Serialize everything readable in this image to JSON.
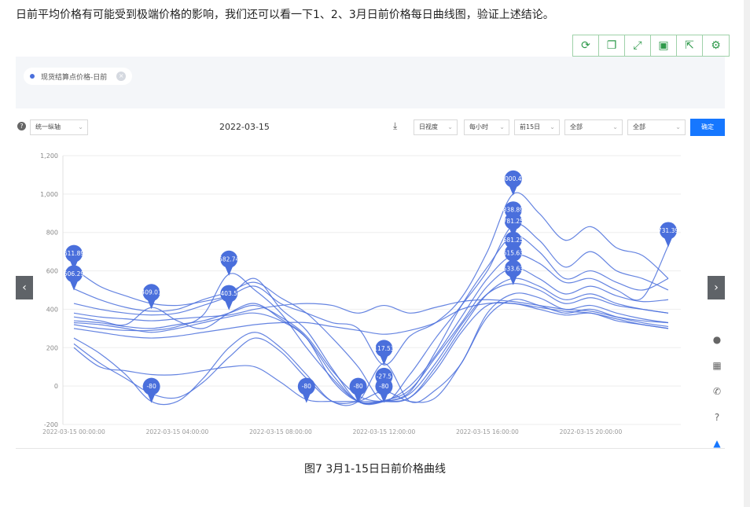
{
  "intro_text": "日前平均价格有可能受到极端价格的影响，我们还可以看一下1、2、3月日前价格每日曲线图，验证上述结论。",
  "toolbar": {
    "icons": [
      "refresh-icon",
      "copy-icon",
      "fullscreen-icon",
      "save-icon",
      "share-icon",
      "settings-icon"
    ]
  },
  "legend": {
    "item": "现货结算点价格-日前",
    "color": "#4a6fdc"
  },
  "controls": {
    "axis_mode": "统一纵轴",
    "date": "2022-03-15",
    "granularity": "日视度",
    "interval": "每小时",
    "range": "前15日",
    "filter1": "全部",
    "filter2": "全部",
    "confirm": "确定"
  },
  "caption": "图7  3月1-15日日前价格曲线",
  "chart_data": {
    "type": "line",
    "title": "",
    "xlabel": "",
    "ylabel": "",
    "ylim": [
      -200,
      1200
    ],
    "yticks": [
      "-200",
      "0",
      "200",
      "400",
      "600",
      "800",
      "1,000",
      "1,200"
    ],
    "xtick_labels": [
      "2022-03-15 00:00:00",
      "2022-03-15 04:00:00",
      "2022-03-15 08:00:00",
      "2022-03-15 12:00:00",
      "2022-03-15 16:00:00",
      "2022-03-15 20:00:00"
    ],
    "x_hours": [
      0,
      1,
      2,
      3,
      4,
      5,
      6,
      7,
      8,
      9,
      10,
      11,
      12,
      13,
      14,
      15,
      16,
      17,
      18,
      19,
      20,
      21,
      22,
      23
    ],
    "series": [
      {
        "values": [
          611.89,
          520,
          470,
          430,
          420,
          440,
          470,
          520,
          430,
          380,
          330,
          300,
          110,
          260,
          330,
          460,
          700,
          1000.46,
          900,
          760,
          830,
          720,
          680,
          560
        ]
      },
      {
        "values": [
          506.29,
          450,
          410,
          390,
          400,
          450,
          490,
          540,
          460,
          380,
          250,
          100,
          -80,
          60,
          250,
          420,
          600,
          838.89,
          760,
          620,
          700,
          600,
          560,
          500
        ]
      },
      {
        "values": [
          320,
          300,
          290,
          290,
          310,
          370,
          582.74,
          500,
          380,
          200,
          40,
          -80,
          -80,
          -30,
          180,
          420,
          620,
          781.25,
          700,
          560,
          600,
          540,
          500,
          560
        ]
      },
      {
        "values": [
          430,
          400,
          380,
          370,
          380,
          420,
          470,
          560,
          403.5,
          290,
          90,
          -80,
          -80,
          0,
          160,
          360,
          560,
          681.25,
          640,
          540,
          560,
          500,
          460,
          731.39
        ]
      },
      {
        "values": [
          360,
          340,
          320,
          409.01,
          340,
          300,
          380,
          430,
          350,
          250,
          30,
          -80,
          -75,
          -20,
          150,
          330,
          520,
          615.63,
          560,
          480,
          520,
          470,
          440,
          450
        ]
      },
      {
        "values": [
          330,
          320,
          300,
          280,
          300,
          330,
          360,
          380,
          340,
          250,
          60,
          -80,
          -80,
          -40,
          120,
          320,
          480,
          533.63,
          500,
          430,
          460,
          420,
          400,
          380
        ]
      },
      {
        "values": [
          250,
          170,
          60,
          -80,
          -80,
          40,
          200,
          280,
          200,
          60,
          -80,
          -80,
          117.53,
          -80,
          -20,
          120,
          380,
          480,
          460,
          400,
          420,
          380,
          350,
          330
        ]
      },
      {
        "values": [
          220,
          120,
          40,
          -40,
          -60,
          20,
          150,
          250,
          180,
          40,
          -80,
          -80,
          -27.5,
          -80,
          -60,
          120,
          360,
          450,
          420,
          380,
          400,
          360,
          330,
          310
        ]
      },
      {
        "values": [
          200,
          100,
          80,
          60,
          60,
          80,
          100,
          100,
          20,
          -70,
          -80,
          -80,
          -80,
          -60,
          80,
          280,
          420,
          430,
          400,
          370,
          380,
          340,
          320,
          300
        ]
      },
      {
        "values": [
          300,
          280,
          260,
          250,
          260,
          280,
          300,
          320,
          330,
          330,
          310,
          290,
          270,
          290,
          330,
          400,
          430,
          430,
          410,
          390,
          380,
          350,
          320,
          300
        ]
      },
      {
        "values": [
          380,
          360,
          350,
          340,
          350,
          360,
          370,
          400,
          420,
          430,
          420,
          380,
          420,
          380,
          410,
          440,
          450,
          440,
          420,
          400,
          390,
          360,
          340,
          330
        ]
      },
      {
        "values": [
          340,
          330,
          310,
          300,
          320,
          340,
          380,
          420,
          360,
          260,
          80,
          -50,
          -80,
          -60,
          100,
          300,
          480,
          560,
          520,
          450,
          480,
          430,
          400,
          380
        ]
      }
    ],
    "markers": [
      {
        "x": 0,
        "y": 611.89,
        "label": "611.89"
      },
      {
        "x": 0,
        "y": 506.29,
        "label": "506.29"
      },
      {
        "x": 3,
        "y": 409.01,
        "label": "409.01"
      },
      {
        "x": 3,
        "y": -80,
        "label": "-80"
      },
      {
        "x": 6,
        "y": 582.74,
        "label": "582.74"
      },
      {
        "x": 6,
        "y": 403.5,
        "label": "403.5"
      },
      {
        "x": 9,
        "y": -80,
        "label": "-80"
      },
      {
        "x": 11,
        "y": -80,
        "label": "-80"
      },
      {
        "x": 12,
        "y": 117.53,
        "label": "117.53"
      },
      {
        "x": 12,
        "y": -27.5,
        "label": "-27.5"
      },
      {
        "x": 12,
        "y": -80,
        "label": "-80"
      },
      {
        "x": 17,
        "y": 1000.46,
        "label": "1000.46"
      },
      {
        "x": 17,
        "y": 838.89,
        "label": "838.89"
      },
      {
        "x": 17,
        "y": 781.25,
        "label": "781.25"
      },
      {
        "x": 17,
        "y": 681.25,
        "label": "681.25"
      },
      {
        "x": 17,
        "y": 615.63,
        "label": "615.63"
      },
      {
        "x": 17,
        "y": 533.63,
        "label": "533.63"
      },
      {
        "x": 23,
        "y": 731.39,
        "label": "731.39"
      }
    ],
    "grid": true
  }
}
